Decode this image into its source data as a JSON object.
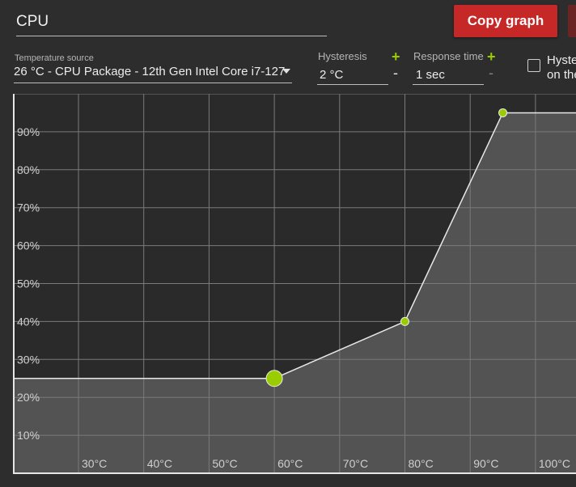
{
  "name_field": {
    "value": "CPU"
  },
  "buttons": {
    "copy_graph": "Copy graph"
  },
  "temperature_source": {
    "label": "Temperature source",
    "value": "26 °C - CPU Package - 12th Gen Intel Core i7-127"
  },
  "hysteresis": {
    "label": "Hysteresis",
    "value": "2 °C",
    "plus": "+",
    "minus": "-"
  },
  "response_time": {
    "label": "Response time",
    "value": "1 sec",
    "plus": "+",
    "minus": "-"
  },
  "checkbox": {
    "line1": "Hyste",
    "line2": "on the",
    "checked": false
  },
  "colors": {
    "accent": "#9acd00",
    "danger_button": "#c62828",
    "background": "#2d2d2d",
    "plot_bg": "#2a2a2a",
    "fill": "#555555"
  },
  "chart_data": {
    "type": "area",
    "x_unit": "°C",
    "xlim": [
      20,
      110
    ],
    "ylim": [
      0,
      100
    ],
    "x_ticks": [
      30,
      40,
      50,
      60,
      70,
      80,
      90,
      100
    ],
    "x_tick_labels": [
      "30°C",
      "40°C",
      "50°C",
      "60°C",
      "70°C",
      "80°C",
      "90°C",
      "100°C"
    ],
    "y_ticks": [
      10,
      20,
      30,
      40,
      50,
      60,
      70,
      80,
      90
    ],
    "y_tick_labels": [
      "10%",
      "20%",
      "30%",
      "40%",
      "50%",
      "60%",
      "70%",
      "80%",
      "90%"
    ],
    "grid": true,
    "points": [
      {
        "x": 20,
        "y": 25,
        "marker": false
      },
      {
        "x": 60,
        "y": 25,
        "marker": true,
        "selected": true
      },
      {
        "x": 80,
        "y": 40,
        "marker": true
      },
      {
        "x": 95,
        "y": 95,
        "marker": true
      },
      {
        "x": 110,
        "y": 95,
        "marker": false
      }
    ]
  }
}
